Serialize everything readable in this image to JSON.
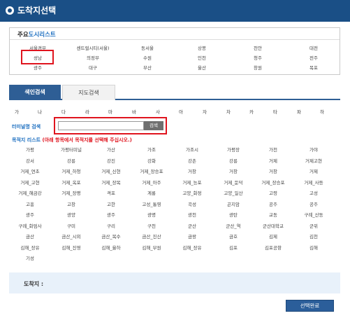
{
  "window": {
    "title": "도착지선택",
    "icon": "circle-bullet-icon"
  },
  "main_cities": {
    "heading_part1": "주요",
    "heading_part2": "도시리스트",
    "rows": [
      [
        "서울경부",
        "센트럴시티(서울)",
        "동서울",
        "상봉",
        "천안",
        "대전"
      ],
      [
        "성남",
        "의정부",
        "수원",
        "인천",
        "청주",
        "전주"
      ],
      [
        "광주",
        "대구",
        "부산",
        "울산",
        "창원",
        "목포"
      ]
    ]
  },
  "tabs": {
    "active": "색인검색",
    "inactive": "지도검색"
  },
  "consonants": [
    "가",
    "나",
    "다",
    "라",
    "마",
    "바",
    "사",
    "아",
    "자",
    "차",
    "카",
    "타",
    "파",
    "하"
  ],
  "search": {
    "label": "터미널명 검색",
    "value": "",
    "button": "검색"
  },
  "list": {
    "title": "목적지 리스트",
    "note": "(아래 항목에서 목적지를 선택해 주십시오.)",
    "rows": [
      [
        "가평",
        "가평터미널",
        "가산",
        "가조",
        "가조시",
        "가평장",
        "가천",
        "가야"
      ],
      [
        "강서",
        "강릉",
        "강진",
        "강화",
        "강촌",
        "강릉",
        "거제",
        "거제고현"
      ],
      [
        "거제_연초",
        "거제_하청",
        "거제_신현",
        "거제_장승포",
        "거창",
        "거창",
        "거창",
        "거제"
      ],
      [
        "거제_고현",
        "거제_옥포",
        "거제_장목",
        "거제_아주",
        "거제_능포",
        "거제_둔덕",
        "거제_장승포",
        "거제_사등"
      ],
      [
        "거제_해금강",
        "거제_장평",
        "격포",
        "계룡",
        "고양_화정",
        "고양_일산",
        "고령",
        "고성"
      ],
      [
        "고흥",
        "고창",
        "고한",
        "고성_통영",
        "곡성",
        "곤지암",
        "공주",
        "공주"
      ],
      [
        "광주",
        "광양",
        "광주",
        "광명",
        "광천",
        "광탄",
        "교동",
        "구례_산동"
      ],
      [
        "구례_화엄사",
        "구미",
        "구리",
        "구천",
        "군산",
        "군산_역",
        "군산대학교",
        "군위"
      ],
      [
        "금산",
        "금산_시외",
        "금산_복수",
        "금산_진산",
        "금왕",
        "금호",
        "김제",
        "김천"
      ],
      [
        "김해_장유",
        "김해_진영",
        "김해_율하",
        "김해_부원",
        "김해_장유",
        "김포",
        "김포공항",
        "김해"
      ],
      [
        "기성"
      ]
    ]
  },
  "arrival": {
    "label": "도착지 :",
    "value": ""
  },
  "confirm_button": "선택완료",
  "colors": {
    "titlebar": "#1a4f86",
    "accent": "#1d6fc0",
    "highlight": "#e0141e",
    "button": "#2b5e9a"
  }
}
